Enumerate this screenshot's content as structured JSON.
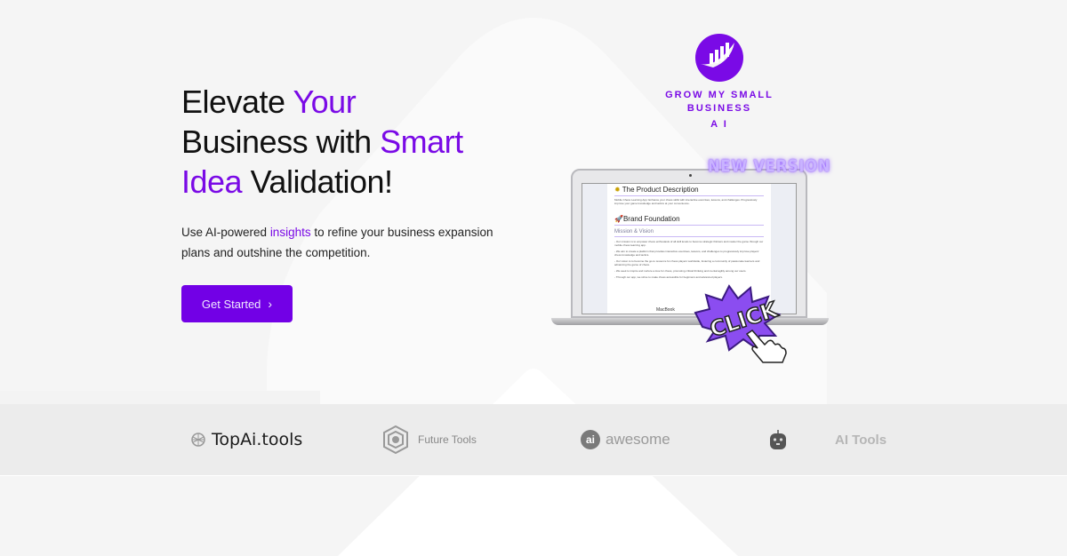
{
  "colors": {
    "accent": "#7a0ae6",
    "button_bg": "#7200e6",
    "page_bg": "#f5f5f5",
    "logo_strip_bg": "#ececec",
    "new_version_glow": "#9b6bff"
  },
  "hero": {
    "headline": {
      "part1": "Elevate ",
      "part2_accent": "Your",
      "part3": "Business with ",
      "part4_accent": "Smart",
      "part5_accent": "Idea",
      "part6": " Validation!"
    },
    "subtext": {
      "part1": "Use AI-powered ",
      "part2_accent": "insights",
      "part3": " to refine your business expansion plans and outshine the competition."
    },
    "cta": {
      "label": "Get Started",
      "icon": "chevron-right-icon",
      "icon_glyph": "›"
    }
  },
  "brand": {
    "icon": "growth-chart-logo-icon",
    "line1": "GROW MY SMALL",
    "line2": "BUSINESS",
    "line3": "A I"
  },
  "showcase": {
    "badge": "NEW VERSION",
    "laptop_label": "MacBook",
    "click_label": "CLICK",
    "doc": {
      "section1_title": "The Product Description",
      "section1_icon": "gear-sun-icon",
      "section1_body": "Mobile Chess Learning App: Enhance your chess skills with interactive exercises, lessons, and challenges. Progressively improve your game knowledge and tactics at your convenience.",
      "section2_title": "Brand Foundation",
      "section2_icon": "rocket-icon",
      "subsection_title": "Mission & Vision",
      "bullets": [
        "- Our mission is to empower chess enthusiasts of all skill levels to become strategic thinkers and master the game through our mobile chess learning app.",
        "- We aim to create a platform that provides interactive exercises, lessons, and challenges to progressively improve players' chess knowledge and tactics.",
        "- Our vision is to become the go-to resource for chess players worldwide, fostering a community of passionate learners and advancing the game of chess.",
        "- We seek to inspire and nurture a love for chess, promoting critical thinking and mental agility among our users.",
        "- Through our app, we strive to make chess accessible for beginners and advanced players."
      ]
    }
  },
  "logos": [
    {
      "name": "TopAi.tools",
      "icon": "network-icon"
    },
    {
      "name": "Future Tools",
      "icon": "hexagon-icon"
    },
    {
      "name": "awesome",
      "icon": "ai-circle-icon",
      "icon_text": "ai"
    },
    {
      "name": "AI Tools",
      "icon": "robot-icon"
    }
  ]
}
